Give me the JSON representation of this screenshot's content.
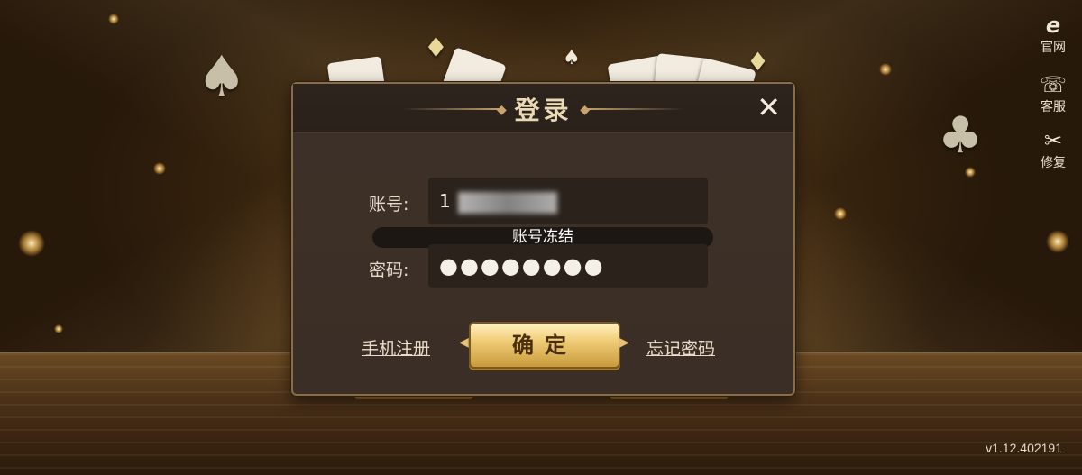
{
  "dialog": {
    "title": "登录",
    "account_label": "账号:",
    "account_value": "1",
    "password_label": "密码:",
    "password_value": "●●●●●●●●",
    "toast": "账号冻结",
    "register_link": "手机注册",
    "confirm_label": "确定",
    "forgot_link": "忘记密码"
  },
  "side": {
    "website_label": "官网",
    "service_label": "客服",
    "repair_label": "修复"
  },
  "version": "v1.12.402191",
  "icons": {
    "website": "ie-browser-icon",
    "service": "chat-phone-icon",
    "repair": "tools-wrench-icon",
    "close": "close-icon"
  },
  "colors": {
    "accent_gold": "#f0cc76",
    "dialog_bg": "#3a2e26",
    "text_light": "#e6dccb"
  }
}
